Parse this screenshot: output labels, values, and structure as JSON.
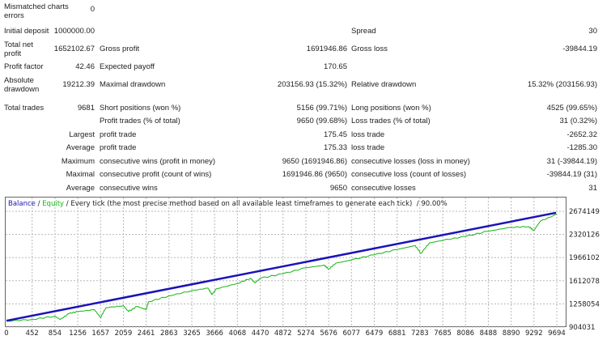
{
  "report": {
    "mismatched_label": "Mismatched charts errors",
    "mismatched_value": "0",
    "initial_deposit_label": "Initial deposit",
    "initial_deposit_value": "1000000.00",
    "spread_label": "Spread",
    "spread_value": "30",
    "total_net_profit_label": "Total net profit",
    "total_net_profit_value": "1652102.67",
    "gross_profit_label": "Gross profit",
    "gross_profit_value": "1691946.86",
    "gross_loss_label": "Gross loss",
    "gross_loss_value": "-39844.19",
    "profit_factor_label": "Profit factor",
    "profit_factor_value": "42.46",
    "expected_payoff_label": "Expected payoff",
    "expected_payoff_value": "170.65",
    "absolute_drawdown_label": "Absolute drawdown",
    "absolute_drawdown_value": "19212.39",
    "maximal_drawdown_label": "Maximal drawdown",
    "maximal_drawdown_value": "203156.93 (15.32%)",
    "relative_drawdown_label": "Relative drawdown",
    "relative_drawdown_value": "15.32% (203156.93)",
    "total_trades_label": "Total trades",
    "total_trades_value": "9681",
    "short_label": "Short positions (won %)",
    "short_value": "5156 (99.71%)",
    "long_label": "Long positions (won %)",
    "long_value": "4525 (99.65%)",
    "profit_trades_label": "Profit trades (% of total)",
    "profit_trades_value": "9650 (99.68%)",
    "loss_trades_label": "Loss trades (% of total)",
    "loss_trades_value": "31 (0.32%)",
    "largest_label": "Largest",
    "largest_profit_label": "profit trade",
    "largest_profit_value": "175.45",
    "largest_loss_label": "loss trade",
    "largest_loss_value": "-2652.32",
    "average_label": "Average",
    "average_profit_label": "profit trade",
    "average_profit_value": "175.33",
    "average_loss_label": "loss trade",
    "average_loss_value": "-1285.30",
    "maximum_label": "Maximum",
    "max_cons_wins_label": "consecutive wins (profit in money)",
    "max_cons_wins_value": "9650 (1691946.86)",
    "max_cons_losses_label": "consecutive losses (loss in money)",
    "max_cons_losses_value": "31 (-39844.19)",
    "maximal_label": "Maximal",
    "maximal_cons_profit_label": "consecutive profit (count of wins)",
    "maximal_cons_profit_value": "1691946.86 (9650)",
    "maximal_cons_loss_label": "consecutive loss (count of losses)",
    "maximal_cons_loss_value": "-39844.19 (31)",
    "average2_label": "Average",
    "avg_cons_wins_label": "consecutive wins",
    "avg_cons_wins_value": "9650",
    "avg_cons_losses_label": "consecutive losses",
    "avg_cons_losses_value": "31"
  },
  "chart_data": {
    "type": "line",
    "legend": {
      "balance": "Balance",
      "sep1": " / ",
      "equity": "Equity",
      "rest": " / Every tick (the most precise method based on all available least timeframes to generate each tick)",
      "quality": "  / 90.00%"
    },
    "colors": {
      "balance": "#1a13b8",
      "equity": "#16b516",
      "grid": "#b8b8b8"
    },
    "xlim": [
      0,
      9694
    ],
    "ylim": [
      904031,
      2674149
    ],
    "x_ticks": [
      "0",
      "452",
      "854",
      "1256",
      "1657",
      "2059",
      "2461",
      "2863",
      "3265",
      "3666",
      "4068",
      "4470",
      "4872",
      "5274",
      "5676",
      "6077",
      "6479",
      "6881",
      "7283",
      "7685",
      "8086",
      "8488",
      "8890",
      "9292",
      "9694"
    ],
    "y_ticks": [
      "2674149",
      "2320126",
      "1966102",
      "1612078",
      "1258054",
      "904031"
    ],
    "grid": true,
    "series": [
      {
        "name": "Balance",
        "x": [
          0,
          9681
        ],
        "y": [
          1000000,
          2652102
        ]
      },
      {
        "name": "Equity",
        "x": [
          0,
          452,
          854,
          950,
          1100,
          1256,
          1550,
          1657,
          1750,
          2059,
          2150,
          2300,
          2461,
          2500,
          2863,
          3265,
          3550,
          3620,
          3700,
          4068,
          4300,
          4380,
          4470,
          4872,
          5274,
          5600,
          5676,
          5800,
          6077,
          6479,
          6881,
          7200,
          7300,
          7450,
          7685,
          8086,
          8488,
          8890,
          9200,
          9292,
          9400,
          9694
        ],
        "y": [
          995000,
          1020000,
          1070000,
          1020000,
          1110000,
          1140000,
          1170000,
          1050000,
          1200000,
          1230000,
          1140000,
          1220000,
          1170000,
          1290000,
          1380000,
          1460000,
          1500000,
          1400000,
          1490000,
          1570000,
          1650000,
          1580000,
          1650000,
          1720000,
          1810000,
          1850000,
          1790000,
          1880000,
          1930000,
          2010000,
          2090000,
          2150000,
          2030000,
          2190000,
          2230000,
          2290000,
          2370000,
          2430000,
          2440000,
          2380000,
          2520000,
          2630000
        ]
      }
    ]
  }
}
